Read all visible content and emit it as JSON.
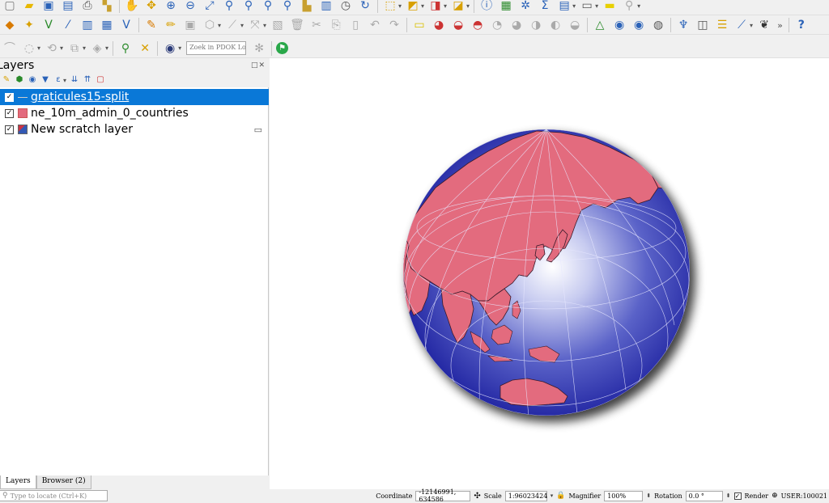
{
  "toolbar": {
    "row1_icons": [
      "new-project-icon",
      "open-project-icon",
      "save-project-icon",
      "save-as-icon",
      "print-layout-icon",
      "layout-manager-icon",
      "style-manager-icon",
      "pan-icon",
      "pan-to-selection-icon",
      "zoom-in-icon",
      "zoom-out-icon",
      "zoom-full-icon",
      "zoom-to-layer-icon",
      "zoom-to-selection-icon",
      "zoom-last-icon",
      "zoom-next-icon",
      "new-bookmark-icon",
      "show-bookmarks-icon",
      "temporal-controller-icon",
      "refresh-icon",
      "select-features-icon",
      "deselect-icon",
      "attribute-select-icon",
      "identify-icon",
      "field-calculator-icon",
      "processing-toolbox-icon",
      "statistics-icon",
      "attribute-table-icon",
      "measure-icon",
      "map-tips-icon",
      "annotation-icon"
    ],
    "row2_icons": [
      "data-source-manager-icon",
      "new-layer-icon",
      "virtual-layer-icon",
      "add-vector-icon",
      "add-wms-icon",
      "add-raster-icon",
      "digitize-pencil-icon",
      "edit-pencil-icon",
      "save-edits-icon",
      "add-polygon-icon",
      "vertex-tool-icon",
      "move-feature-icon",
      "delete-feature-icon",
      "cut-icon",
      "copy-icon",
      "paste-icon",
      "undo-icon",
      "redo-icon",
      "label-icon",
      "label-pin-icon",
      "label-move-icon",
      "label-rotate-icon",
      "diagram-icon",
      "label-show-icon",
      "label-change-icon",
      "qgis-grid-icon",
      "georef-icon",
      "globe-a-icon",
      "globe-b-icon",
      "python-icon",
      "metasearch-icon",
      "db-manager-icon",
      "profile-icon",
      "plugin-icon",
      "help-icon"
    ],
    "row3_icons": [
      "advanced-digitize-icon",
      "shape-digitize-icon",
      "rotate-feature-icon",
      "offset-curve-icon",
      "split-feature-icon",
      "search-map-icon",
      "crs-icon",
      "pdok-globe-icon"
    ],
    "locator_placeholder": "Zoek in PDOK Loc···",
    "extra_icon": "green-share-icon"
  },
  "layers_panel": {
    "title": "Layers",
    "close_label": "□✕",
    "tool_icons": [
      "style-panel-icon",
      "add-group-icon",
      "manage-theme-icon",
      "filter-legend-icon",
      "filter-expression-icon",
      "expand-all-icon",
      "collapse-all-icon",
      "remove-layer-icon"
    ],
    "layers": [
      {
        "name": "graticules15-split",
        "checked": true,
        "selected": true,
        "symbol": "line"
      },
      {
        "name": "ne_10m_admin_0_countries",
        "checked": true,
        "selected": false,
        "symbol": "fill",
        "color": "#e36b7e"
      },
      {
        "name": "New scratch layer",
        "checked": true,
        "selected": false,
        "symbol": "scratch"
      }
    ],
    "tabs": [
      "Layers",
      "Browser (2)"
    ]
  },
  "map": {
    "globe_ocean_color": "#2a2fa8",
    "land_color": "#e36b7e",
    "graticule_color": "#e8e8ff"
  },
  "statusbar": {
    "locate_placeholder": "Type to locate (Ctrl+K)",
    "coordinate_label": "Coordinate",
    "coordinate_value": "-12146991, 634586",
    "scale_label": "Scale",
    "scale_value": "1:96023424",
    "magnifier_label": "Magnifier",
    "magnifier_value": "100%",
    "rotation_label": "Rotation",
    "rotation_value": "0.0 °",
    "render_label": "Render",
    "crs_label": "USER:100021"
  }
}
